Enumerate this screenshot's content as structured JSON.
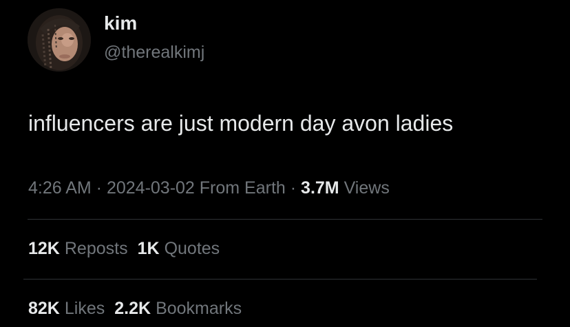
{
  "user": {
    "display_name": "kim",
    "handle": "@therealkimj"
  },
  "tweet": {
    "text": "influencers are just modern day avon ladies"
  },
  "meta": {
    "time": "4:26 AM",
    "separator1": " · ",
    "date": "2024-03-02",
    "source": " From Earth",
    "separator2": " · ",
    "views_count": "3.7M",
    "views_label": " Views"
  },
  "stats": {
    "reposts_count": "12K",
    "reposts_label": "Reposts",
    "quotes_count": "1K",
    "quotes_label": "Quotes",
    "likes_count": "82K",
    "likes_label": "Likes",
    "bookmarks_count": "2.2K",
    "bookmarks_label": "Bookmarks"
  },
  "colors": {
    "background": "#000000",
    "primary_text": "#e7e9ea",
    "secondary_text": "#71767b",
    "divider": "#2f3336"
  }
}
